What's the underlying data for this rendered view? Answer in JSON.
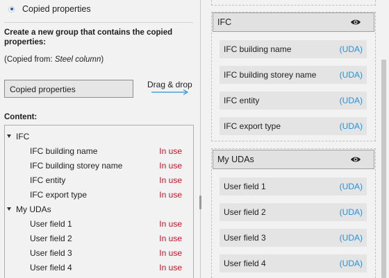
{
  "option": {
    "label": "Copied properties",
    "selected": true
  },
  "description": "Create a new group that contains the copied properties:",
  "copied_from": {
    "prefix": "(Copied from: ",
    "source": "Steel column",
    "suffix": ")"
  },
  "group_name": "Copied properties",
  "drag_hint": "Drag & drop",
  "content_label": "Content:",
  "tree": {
    "groups": [
      {
        "name": "IFC",
        "items": [
          {
            "name": "IFC building name",
            "status": "In use"
          },
          {
            "name": "IFC building storey name",
            "status": "In use"
          },
          {
            "name": "IFC entity",
            "status": "In use"
          },
          {
            "name": "IFC export type",
            "status": "In use"
          }
        ]
      },
      {
        "name": "My UDAs",
        "items": [
          {
            "name": "User field 1",
            "status": "In use"
          },
          {
            "name": "User field 2",
            "status": "In use"
          },
          {
            "name": "User field 3",
            "status": "In use"
          },
          {
            "name": "User field 4",
            "status": "In use"
          }
        ]
      }
    ]
  },
  "sections": [
    {
      "title": "IFC",
      "icon": "eye-icon",
      "props": [
        {
          "name": "IFC building name",
          "tag": "(UDA)"
        },
        {
          "name": "IFC building storey name",
          "tag": "(UDA)"
        },
        {
          "name": "IFC entity",
          "tag": "(UDA)"
        },
        {
          "name": "IFC export type",
          "tag": "(UDA)"
        }
      ]
    },
    {
      "title": "My UDAs",
      "icon": "eye-icon",
      "props": [
        {
          "name": "User field 1",
          "tag": "(UDA)"
        },
        {
          "name": "User field 2",
          "tag": "(UDA)"
        },
        {
          "name": "User field 3",
          "tag": "(UDA)"
        },
        {
          "name": "User field 4",
          "tag": "(UDA)"
        }
      ]
    }
  ],
  "colors": {
    "in_use": "#c4142a",
    "uda": "#2b8ed4",
    "accent": "#2c5aa0"
  }
}
